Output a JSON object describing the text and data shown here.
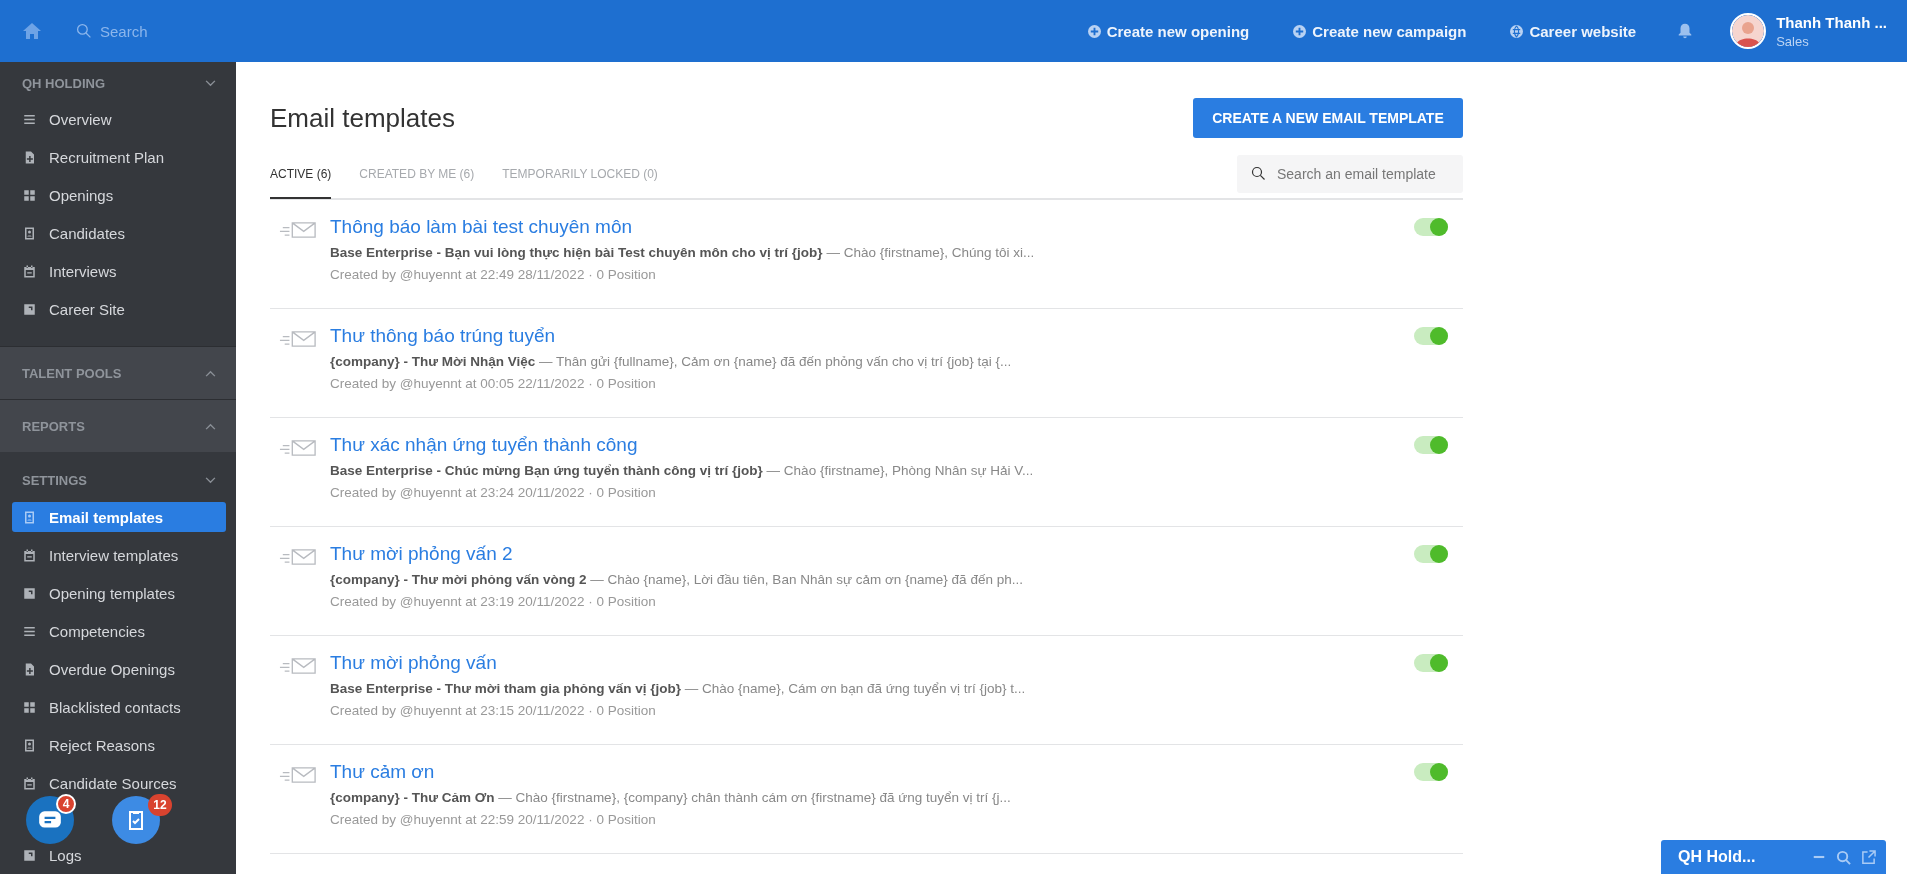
{
  "top_bar": {
    "search_placeholder": "Search",
    "actions": [
      "Create new opening",
      "Create new campaign",
      "Career website"
    ],
    "user": {
      "name": "Thanh Thanh ...",
      "role": "Sales"
    }
  },
  "sidebar": {
    "sections": [
      {
        "title": "QH HOLDING",
        "expanded": true,
        "items": [
          {
            "label": "Overview",
            "selected": false
          },
          {
            "label": "Recruitment Plan",
            "selected": false
          },
          {
            "label": "Openings",
            "selected": false
          },
          {
            "label": "Candidates",
            "selected": false
          },
          {
            "label": "Interviews",
            "selected": false
          },
          {
            "label": "Career Site",
            "selected": false
          }
        ]
      },
      {
        "title": "TALENT POOLS",
        "expanded": false
      },
      {
        "title": "REPORTS",
        "expanded": false
      },
      {
        "title": "SETTINGS",
        "expanded": true,
        "items": [
          {
            "label": "Email templates",
            "selected": true
          },
          {
            "label": "Interview templates",
            "selected": false
          },
          {
            "label": "Opening templates",
            "selected": false
          },
          {
            "label": "Competencies",
            "selected": false
          },
          {
            "label": "Overdue Openings",
            "selected": false
          },
          {
            "label": "Blacklisted contacts",
            "selected": false
          },
          {
            "label": "Reject Reasons",
            "selected": false
          },
          {
            "label": "Candidate Sources",
            "selected": false
          },
          {
            "label": "Logs",
            "selected": false
          }
        ]
      }
    ]
  },
  "page": {
    "title": "Email templates",
    "create_button": "CREATE A NEW EMAIL TEMPLATE",
    "tabs": [
      {
        "label": "ACTIVE (6)",
        "selected": true
      },
      {
        "label": "CREATED BY ME (6)",
        "selected": false
      },
      {
        "label": "TEMPORARILY LOCKED (0)",
        "selected": false
      }
    ],
    "search": {
      "placeholder": "Search an email template"
    },
    "templates": [
      {
        "title": "Thông báo làm bài test chuyên môn",
        "subject": "Base Enterprise - Bạn vui lòng thực hiện bài Test chuyên môn cho vị trí {job}",
        "preview": "— Chào {firstname}, Chúng tôi xi...",
        "meta": "Created by @huyennt at 22:49 28/11/2022 · 0 Position",
        "on": true
      },
      {
        "title": "Thư thông báo trúng tuyển",
        "subject": "{company} - Thư Mời Nhận Việc",
        "preview": "— Thân gửi {fullname}, Cảm ơn {name} đã đến phỏng vấn cho vị trí {job} tại {...",
        "meta": "Created by @huyennt at 00:05 22/11/2022 · 0 Position",
        "on": true
      },
      {
        "title": "Thư xác nhận ứng tuyển thành công",
        "subject": "Base Enterprise - Chúc mừng Bạn ứng tuyển thành công vị trí {job}",
        "preview": "— Chào {firstname}, Phòng Nhân sự Hải V...",
        "meta": "Created by @huyennt at 23:24 20/11/2022 · 0 Position",
        "on": true
      },
      {
        "title": "Thư mời phỏng vấn 2",
        "subject": "{company} - Thư mời phỏng vấn vòng 2",
        "preview": "— Chào {name}, Lời đầu tiên, Ban Nhân sự cảm ơn {name} đã đến ph...",
        "meta": "Created by @huyennt at 23:19 20/11/2022 · 0 Position",
        "on": true
      },
      {
        "title": "Thư mời phỏng vấn",
        "subject": "Base Enterprise - Thư mời tham gia phỏng vấn vị {job}",
        "preview": "— Chào {name}, Cám ơn bạn đã ứng tuyển vị trí {job} t...",
        "meta": "Created by @huyennt at 23:15 20/11/2022 · 0 Position",
        "on": true
      },
      {
        "title": "Thư cảm ơn",
        "subject": "{company} - Thư Cảm Ơn",
        "preview": "— Chào {firstname}, {company} chân thành cám ơn {firstname} đã ứng tuyển vị trí {j...",
        "meta": "Created by @huyennt at 22:59 20/11/2022 · 0 Position",
        "on": true
      }
    ]
  },
  "floating_buttons": [
    {
      "badge": "4"
    },
    {
      "badge": "12"
    }
  ],
  "chat_panel": {
    "title": "QH Hold..."
  }
}
